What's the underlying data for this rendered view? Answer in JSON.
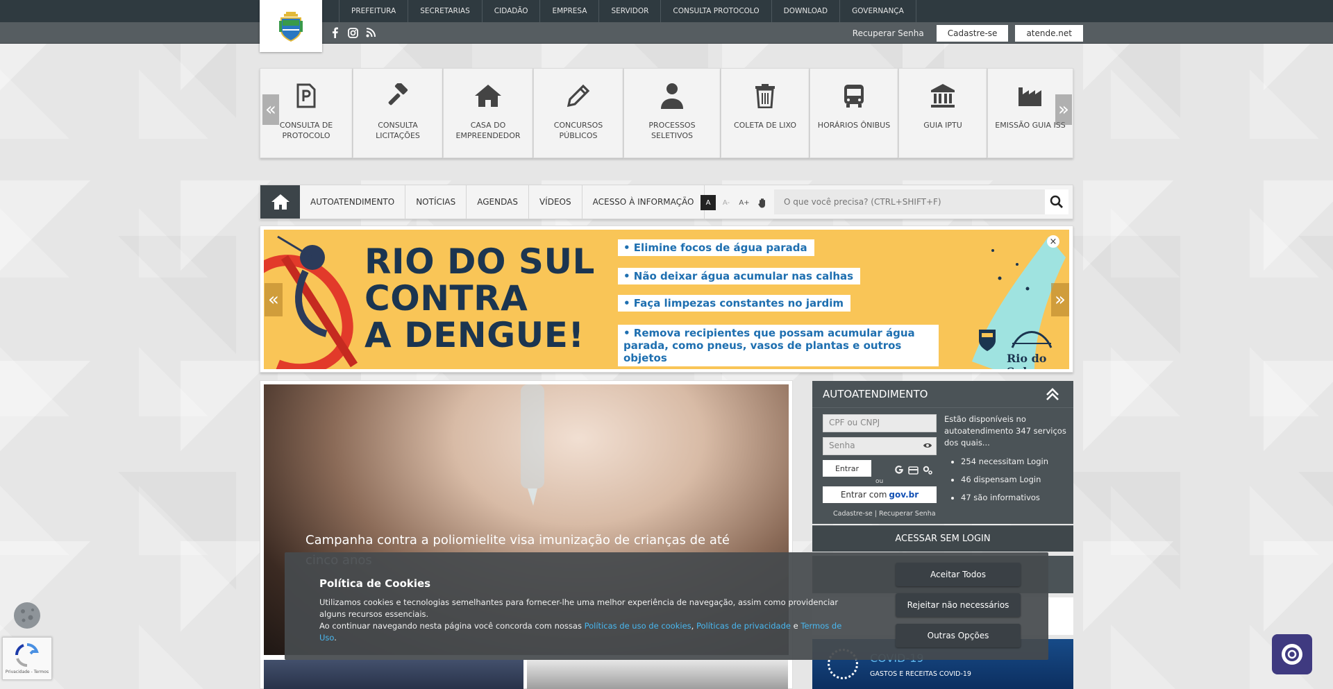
{
  "header": {
    "nav": [
      "PREFEITURA",
      "SECRETARIAS",
      "CIDADÃO",
      "EMPRESA",
      "SERVIDOR",
      "CONSULTA PROTOCOLO",
      "DOWNLOAD",
      "GOVERNANÇA"
    ],
    "recover_label": "Recuperar Senha",
    "signup_label": "Cadastre-se",
    "atende_label": "atende.net",
    "social_icons": [
      "facebook-icon",
      "instagram-icon",
      "rss-icon"
    ]
  },
  "quick_access": {
    "prev_label": "«",
    "next_label": "»",
    "items": [
      {
        "label": "CONSULTA DE PROTOCOLO",
        "icon": "protocol-document-icon"
      },
      {
        "label": "CONSULTA LICITAÇÕES",
        "icon": "gavel-icon"
      },
      {
        "label": "CASA DO EMPREENDEDOR",
        "icon": "house-icon"
      },
      {
        "label": "CONCURSOS PÚBLICOS",
        "icon": "pencil-icon"
      },
      {
        "label": "PROCESSOS SELETIVOS",
        "icon": "person-icon"
      },
      {
        "label": "COLETA DE LIXO",
        "icon": "trash-icon"
      },
      {
        "label": "HORÁRIOS ÔNIBUS",
        "icon": "bus-icon"
      },
      {
        "label": "GUIA IPTU",
        "icon": "bank-icon"
      },
      {
        "label": "EMISSÃO GUIA ISS",
        "icon": "factory-icon"
      }
    ]
  },
  "main_nav": {
    "links": [
      "AUTOATENDIMENTO",
      "NOTÍCIAS",
      "AGENDAS",
      "VÍDEOS",
      "ACESSO À INFORMAÇÃO"
    ],
    "font_controls": [
      "A",
      "A-",
      "A+"
    ],
    "search_placeholder": "O que você precisa? (CTRL+SHIFT+F)"
  },
  "banner": {
    "title_lines": [
      "RIO DO SUL",
      "CONTRA",
      "A DENGUE!"
    ],
    "bullets": [
      "• Elimine focos de água parada",
      "• Não deixar água acumular nas calhas",
      "• Faça limpezas constantes no jardim",
      "• Remova recipientes que possam acumular água parada, como pneus, vasos de plantas e outros objetos"
    ],
    "brand": "Rio do Sul",
    "close_label": "×",
    "prev_label": "«",
    "next_label": "»"
  },
  "news": {
    "headline": "Campanha contra a poliomielite visa imunização de crianças de até cinco anos"
  },
  "autoatendimento": {
    "title": "AUTOATENDIMENTO",
    "cpf_placeholder": "CPF ou CNPJ",
    "password_placeholder": "Senha",
    "enter_label": "Entrar",
    "or_label": "ou",
    "govbr_prefix": "Entrar com",
    "govbr_logo": "gov.br",
    "signup_link": "Cadastre-se",
    "recover_link": "Recuperar Senha",
    "link_separator": "|",
    "info_text": "Estão disponíveis no autoatendimento 347 serviços dos quais...",
    "stats": [
      "254 necessitam Login",
      "46 dispensam Login",
      "47 são informativos"
    ],
    "without_login_label": "ACESSAR SEM LOGIN"
  },
  "covid": {
    "title": "COVID-19",
    "subtitle": "GASTOS E RECEITAS COVID-19"
  },
  "cookie": {
    "title": "Política de Cookies",
    "text1": "Utilizamos cookies e tecnologias semelhantes para fornecer-lhe uma melhor experiência de navegação, assim como providenciar alguns recursos essenciais.",
    "text2_prefix": "Ao continuar navegando nesta página você concorda com nossas",
    "link_cookies": "Políticas de uso de cookies",
    "comma": ",",
    "link_privacy": "Políticas de privacidade",
    "conj": "e",
    "link_terms": "Termos de Uso",
    "period": ".",
    "accept_label": "Aceitar Todos",
    "reject_label": "Rejeitar não necessários",
    "options_label": "Outras Opções"
  },
  "recaptcha": {
    "text": "Privacidade - Termos"
  }
}
